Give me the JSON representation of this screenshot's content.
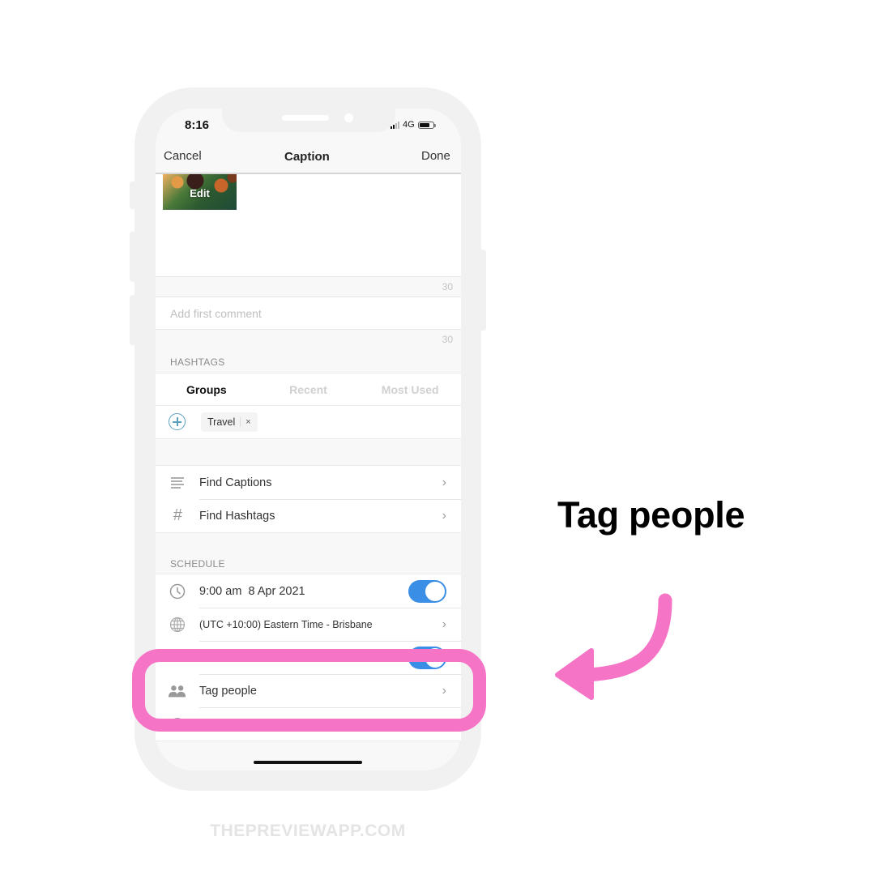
{
  "status_bar": {
    "time": "8:16",
    "network": "4G",
    "signal_bars": 2,
    "signal_bars_total": 4,
    "battery_level": 0.75
  },
  "nav": {
    "cancel_label": "Cancel",
    "title": "Caption",
    "done_label": "Done"
  },
  "caption": {
    "thumbnail_label": "Edit",
    "char_count": "30"
  },
  "first_comment": {
    "placeholder": "Add first comment",
    "value": "",
    "char_count": "30"
  },
  "hashtags": {
    "section_label": "HASHTAGS",
    "tabs": [
      {
        "label": "Groups",
        "active": true
      },
      {
        "label": "Recent",
        "active": false
      },
      {
        "label": "Most Used",
        "active": false
      }
    ],
    "selected_groups": [
      {
        "label": "Travel",
        "remove_icon": "×"
      }
    ]
  },
  "tools": [
    {
      "label": "Find Captions",
      "icon": "lines-icon"
    },
    {
      "label": "Find Hashtags",
      "icon": "hashtag-icon"
    }
  ],
  "schedule": {
    "section_label": "SCHEDULE",
    "datetime": "9:00 am  8 Apr 2021",
    "datetime_enabled": true,
    "timezone": "(UTC +10:00) Eastern Time - Brisbane",
    "hidden_row_toggle_enabled": true,
    "tag_people_label": "Tag people"
  },
  "annotation": {
    "callout": "Tag people",
    "accent_color": "#f674c6",
    "footer": "THEPREVIEWAPP.COM"
  },
  "colors": {
    "toggle_on": "#3a8ee6",
    "add_icon": "#5aa0bf"
  }
}
